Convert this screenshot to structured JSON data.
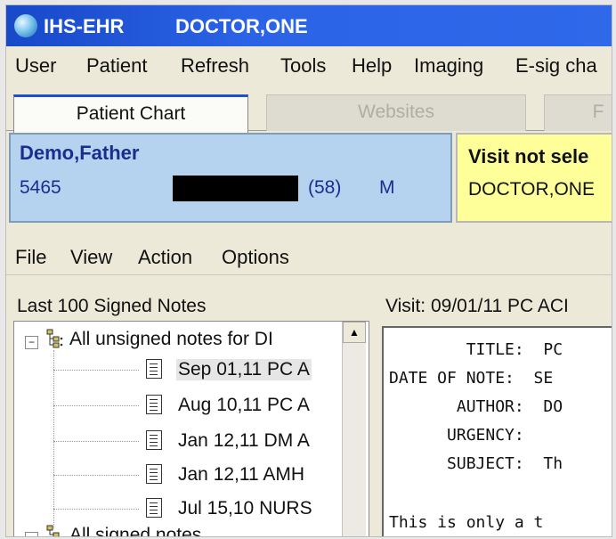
{
  "window": {
    "app_title": "IHS-EHR",
    "user": "DOCTOR,ONE"
  },
  "menubar": [
    "User",
    "Patient",
    "Refresh",
    "Tools",
    "Help",
    "Imaging",
    "E-sig cha"
  ],
  "tabs": {
    "active": "Patient Chart",
    "second": "Websites",
    "third": "F"
  },
  "patient": {
    "name": "Demo,Father",
    "number": "5465",
    "age": "(58)",
    "sex": "M"
  },
  "visit": {
    "status": "Visit not sele",
    "provider": "DOCTOR,ONE"
  },
  "notes_menu": [
    "File",
    "View",
    "Action",
    "Options"
  ],
  "left_panel": {
    "label": "Last 100 Signed Notes",
    "tree_root": "All unsigned notes for DI",
    "notes": [
      {
        "date": "Sep 01,11",
        "title": "PC A"
      },
      {
        "date": "Aug 10,11",
        "title": "PC A"
      },
      {
        "date": "Jan 12,11",
        "title": "DM A"
      },
      {
        "date": "Jan 12,11",
        "title": "AMH"
      },
      {
        "date": "Jul 15,10",
        "title": "NURS"
      }
    ],
    "tree_root2": "All signed notes"
  },
  "right_panel": {
    "visit_label": "Visit: 09/01/11   PC ACI",
    "lines": [
      "        TITLE:  PC",
      "DATE OF NOTE:  SE",
      "       AUTHOR:  DO",
      "      URGENCY:",
      "      SUBJECT:  Th",
      "",
      "This is only a t"
    ]
  },
  "colors": {
    "titlebar": "#2b63e6",
    "patient_bg": "#b5d3ee",
    "visit_bg": "#ffff99",
    "patient_text": "#1b2d8f"
  }
}
